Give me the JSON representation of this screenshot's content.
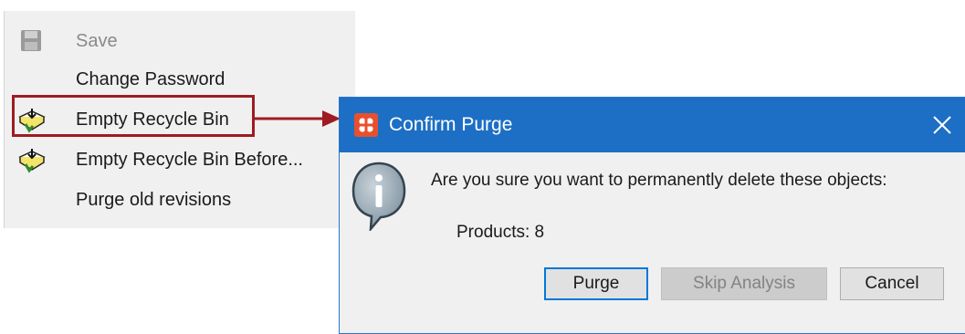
{
  "menu": {
    "items": [
      {
        "label": "Save",
        "icon": "save-icon",
        "enabled": false
      },
      {
        "label": "Change Password",
        "icon": null,
        "enabled": true
      },
      {
        "label": "Empty Recycle Bin",
        "icon": "recycle-bin-icon",
        "enabled": true,
        "highlighted": true
      },
      {
        "label": "Empty Recycle Bin Before...",
        "icon": "recycle-bin-icon",
        "enabled": true
      },
      {
        "label": "Purge old revisions",
        "icon": null,
        "enabled": true
      }
    ]
  },
  "dialog": {
    "title": "Confirm Purge",
    "message": "Are you sure you want to permanently delete these objects:",
    "detail": "Products: 8",
    "buttons": {
      "purge": "Purge",
      "skip": "Skip Analysis",
      "cancel": "Cancel"
    }
  },
  "colors": {
    "titlebar": "#1c6fc4",
    "highlight": "#9e1b23",
    "app_icon": "#e8502d",
    "primary_border": "#0078d7"
  }
}
